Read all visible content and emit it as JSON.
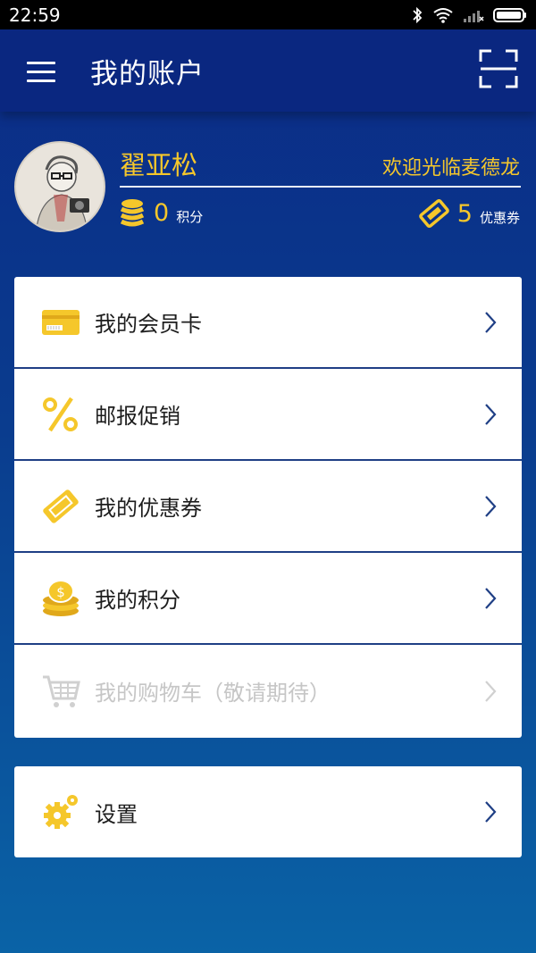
{
  "status_bar": {
    "time": "22:59",
    "icons": [
      "bluetooth-icon",
      "wifi-icon",
      "signal-icon",
      "battery-icon"
    ]
  },
  "app_bar": {
    "title": "我的账户",
    "menu_icon": "hamburger-menu-icon",
    "scan_icon": "scan-frame-icon"
  },
  "profile": {
    "name": "翟亚松",
    "welcome": "欢迎光临麦德龙",
    "points_value": "0",
    "points_label": "积分",
    "coupons_value": "5",
    "coupons_label": "优惠券"
  },
  "menu": {
    "items": [
      {
        "label": "我的会员卡",
        "icon": "member-card-icon",
        "enabled": true
      },
      {
        "label": "邮报促销",
        "icon": "percent-icon",
        "enabled": true
      },
      {
        "label": "我的优惠券",
        "icon": "coupon-ticket-icon",
        "enabled": true
      },
      {
        "label": "我的积分",
        "icon": "coin-stack-icon",
        "enabled": true
      },
      {
        "label": "我的购物车（敬请期待）",
        "icon": "shopping-cart-icon",
        "enabled": false
      }
    ]
  },
  "settings": {
    "label": "设置",
    "icon": "gear-icon"
  },
  "colors": {
    "accent_yellow": "#f5c72b",
    "app_bar": "#0a2780",
    "divider_blue": "#1f3f85"
  }
}
